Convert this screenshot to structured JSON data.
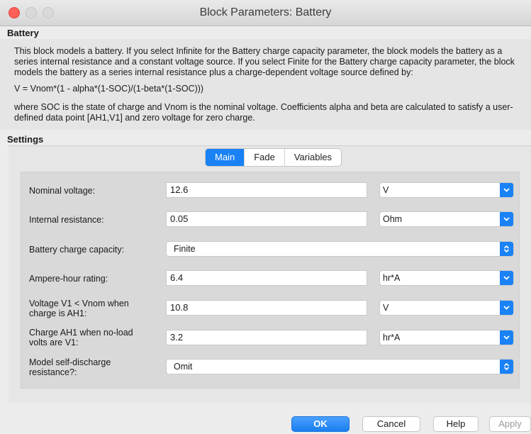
{
  "window": {
    "title": "Block Parameters: Battery"
  },
  "block_name": "Battery",
  "description": {
    "p1": "This block models a battery. If you select Infinite for the Battery charge capacity parameter, the block models the battery as a series internal resistance and a constant voltage source. If you select Finite for the Battery charge capacity parameter, the block models the battery as a series internal resistance plus a charge-dependent voltage source defined by:",
    "equation": "V = Vnom*(1 - alpha*(1-SOC)/(1-beta*(1-SOC)))",
    "p2": "where SOC is the state of charge and Vnom is the nominal voltage. Coefficients alpha and beta are calculated to satisfy a user-defined data point [AH1,V1] and zero voltage for zero charge."
  },
  "settings_label": "Settings",
  "tabs": [
    {
      "label": "Main",
      "active": true
    },
    {
      "label": "Fade",
      "active": false
    },
    {
      "label": "Variables",
      "active": false
    }
  ],
  "params": {
    "nominal_voltage": {
      "label": "Nominal voltage:",
      "value": "12.6",
      "unit": "V"
    },
    "internal_resistance": {
      "label": "Internal resistance:",
      "value": "0.05",
      "unit": "Ohm"
    },
    "charge_capacity": {
      "label": "Battery charge capacity:",
      "value": "Finite"
    },
    "ampere_hour": {
      "label": "Ampere-hour rating:",
      "value": "6.4",
      "unit": "hr*A"
    },
    "voltage_v1": {
      "label_l1": "Voltage V1 < Vnom when",
      "label_l2": "charge is AH1:",
      "value": "10.8",
      "unit": "V"
    },
    "charge_ah1": {
      "label_l1": "Charge AH1 when no-load",
      "label_l2": "volts are V1:",
      "value": "3.2",
      "unit": "hr*A"
    },
    "self_discharge": {
      "label_l1": "Model self-discharge",
      "label_l2": "resistance?:",
      "value": "Omit"
    }
  },
  "buttons": {
    "ok": "OK",
    "cancel": "Cancel",
    "help": "Help",
    "apply": "Apply"
  },
  "colors": {
    "accent": "#1a82f5",
    "close": "#fe5f57"
  }
}
